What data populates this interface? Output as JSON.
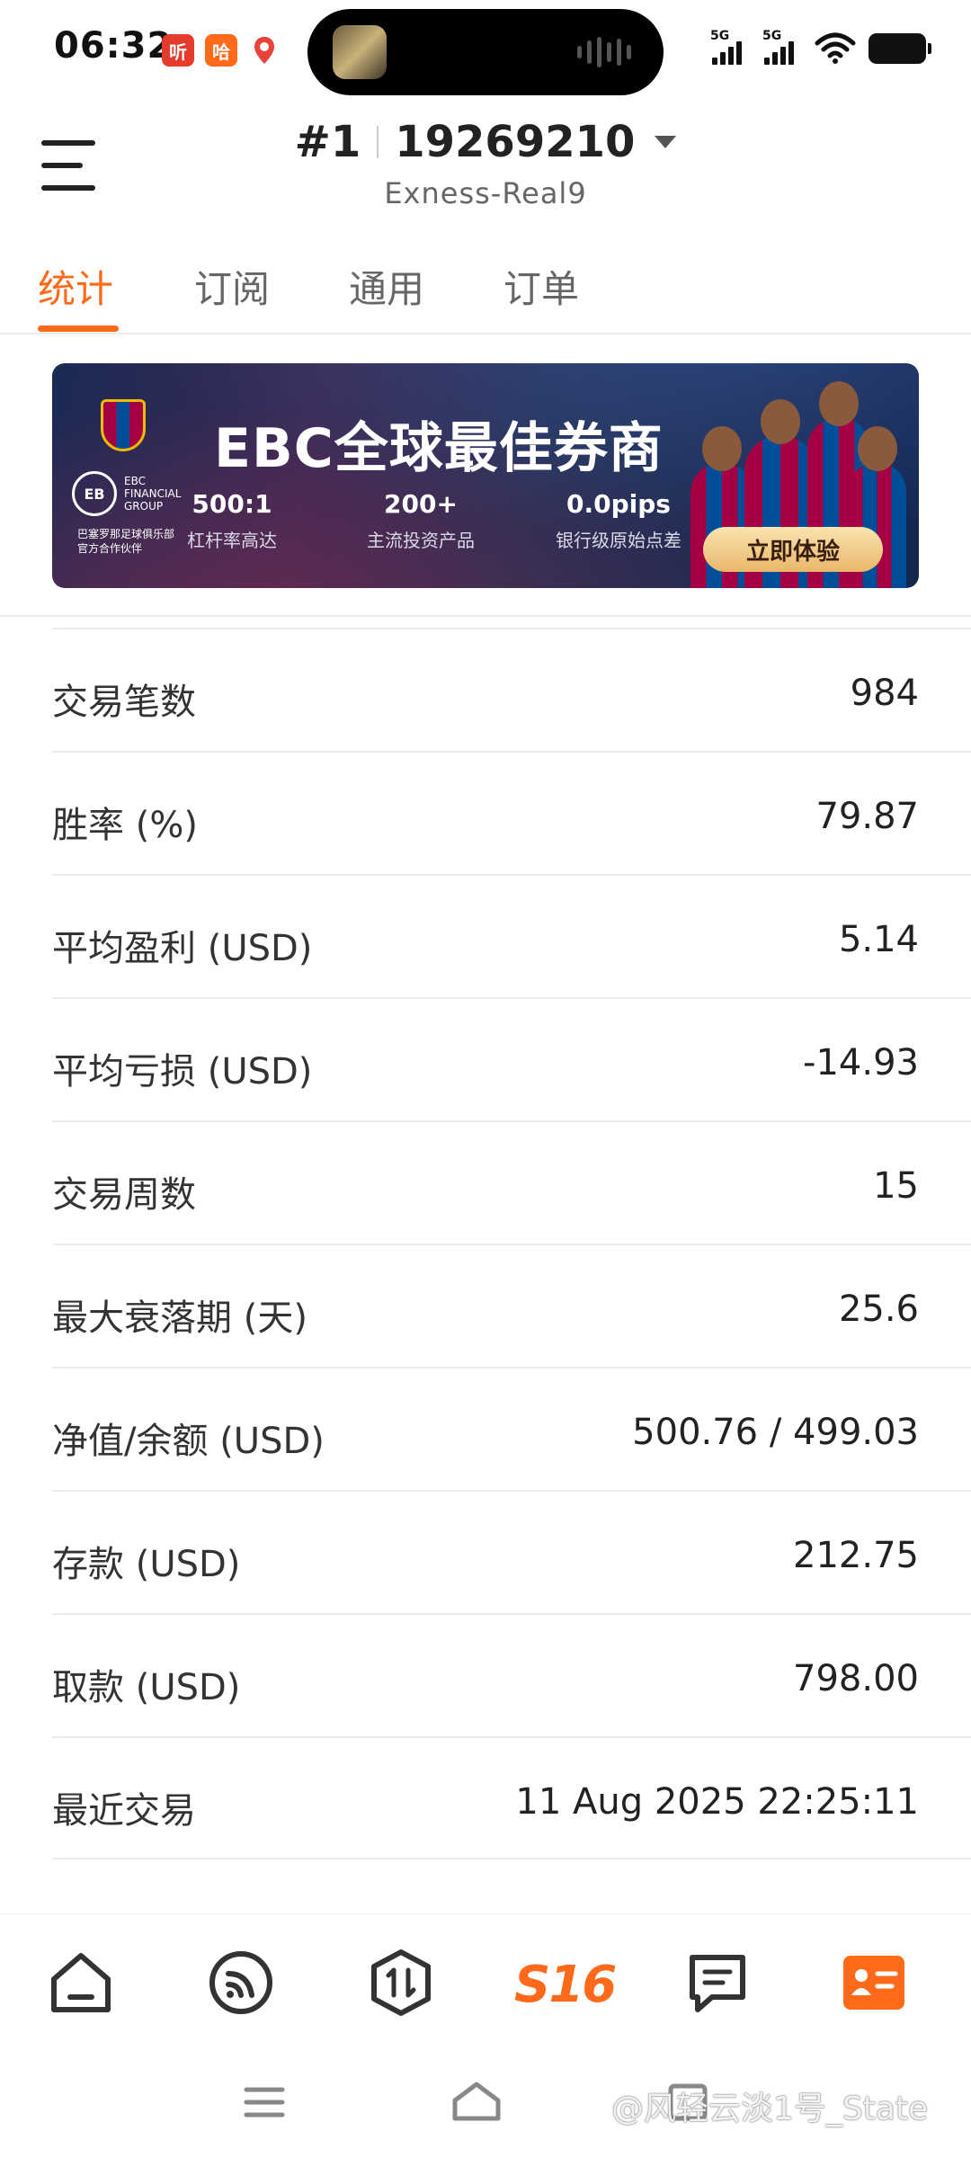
{
  "status_bar": {
    "time": "06:32",
    "app_icons": [
      "听",
      "哈",
      "map"
    ],
    "signal_labels": [
      "5G",
      "5G"
    ]
  },
  "header": {
    "account_rank": "#1",
    "account_number": "19269210",
    "server": "Exness-Real9"
  },
  "tabs": [
    {
      "label": "统计",
      "active": true
    },
    {
      "label": "订阅",
      "active": false
    },
    {
      "label": "通用",
      "active": false
    },
    {
      "label": "订单",
      "active": false
    }
  ],
  "banner": {
    "title": "EBC全球最佳券商",
    "brand_line1": "EBC",
    "brand_line2": "FINANCIAL",
    "brand_line3": "GROUP",
    "partner_line1": "巴塞罗那足球俱乐部",
    "partner_line2": "官方合作伙伴",
    "stats": [
      {
        "value": "500:1",
        "label": "杠杆率高达"
      },
      {
        "value": "200+",
        "label": "主流投资产品"
      },
      {
        "value": "0.0pips",
        "label": "银行级原始点差"
      }
    ],
    "cta": "立即体验"
  },
  "stats": [
    {
      "label": "交易笔数",
      "value": "984"
    },
    {
      "label": "胜率 (%)",
      "value": "79.87"
    },
    {
      "label": "平均盈利 (USD)",
      "value": "5.14"
    },
    {
      "label": "平均亏损 (USD)",
      "value": "-14.93"
    },
    {
      "label": "交易周数",
      "value": "15"
    },
    {
      "label": "最大衰落期 (天)",
      "value": "25.6"
    },
    {
      "label": "净值/余额 (USD)",
      "value": "500.76 / 499.03"
    },
    {
      "label": "存款 (USD)",
      "value": "212.75"
    },
    {
      "label": "取款 (USD)",
      "value": "798.00"
    },
    {
      "label": "最近交易",
      "value": "11 Aug 2025 22:25:11"
    }
  ],
  "bottom_nav": {
    "brand": "S16",
    "items": [
      "home-icon",
      "feed-icon",
      "trade-icon",
      "brand-logo",
      "message-icon",
      "profile-card-icon"
    ]
  },
  "watermark": "@风轻云淡1号_State",
  "colors": {
    "accent": "#ff6a1a",
    "text": "#222222",
    "divider": "#ececec"
  }
}
